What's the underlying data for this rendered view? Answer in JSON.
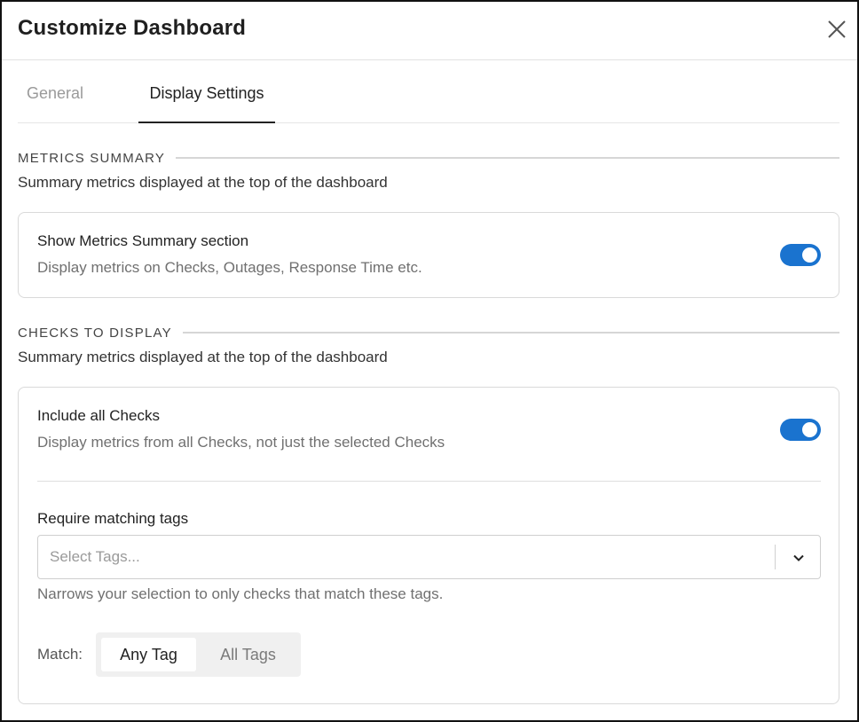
{
  "dialog": {
    "title": "Customize Dashboard",
    "close_icon": "close-icon"
  },
  "tabs": [
    {
      "label": "General",
      "active": false
    },
    {
      "label": "Display Settings",
      "active": true
    }
  ],
  "metrics_summary": {
    "heading": "METRICS SUMMARY",
    "description": "Summary metrics displayed at the top of the dashboard",
    "toggle_title": "Show Metrics Summary section",
    "toggle_description": "Display metrics on Checks, Outages, Response Time etc.",
    "enabled": true
  },
  "checks_to_display": {
    "heading": "CHECKS TO DISPLAY",
    "description": "Summary metrics displayed at the top of the dashboard",
    "toggle_title": "Include all Checks",
    "toggle_description": "Display metrics from all Checks, not just the selected Checks",
    "enabled": true,
    "tags_label": "Require matching tags",
    "tags_placeholder": "Select Tags...",
    "tags_help": "Narrows your selection to only checks that match these tags.",
    "match_label": "Match:",
    "match_options": [
      "Any Tag",
      "All Tags"
    ],
    "match_selected": "Any Tag"
  },
  "colors": {
    "accent": "#1a73cf",
    "border": "#d9d9d9"
  }
}
